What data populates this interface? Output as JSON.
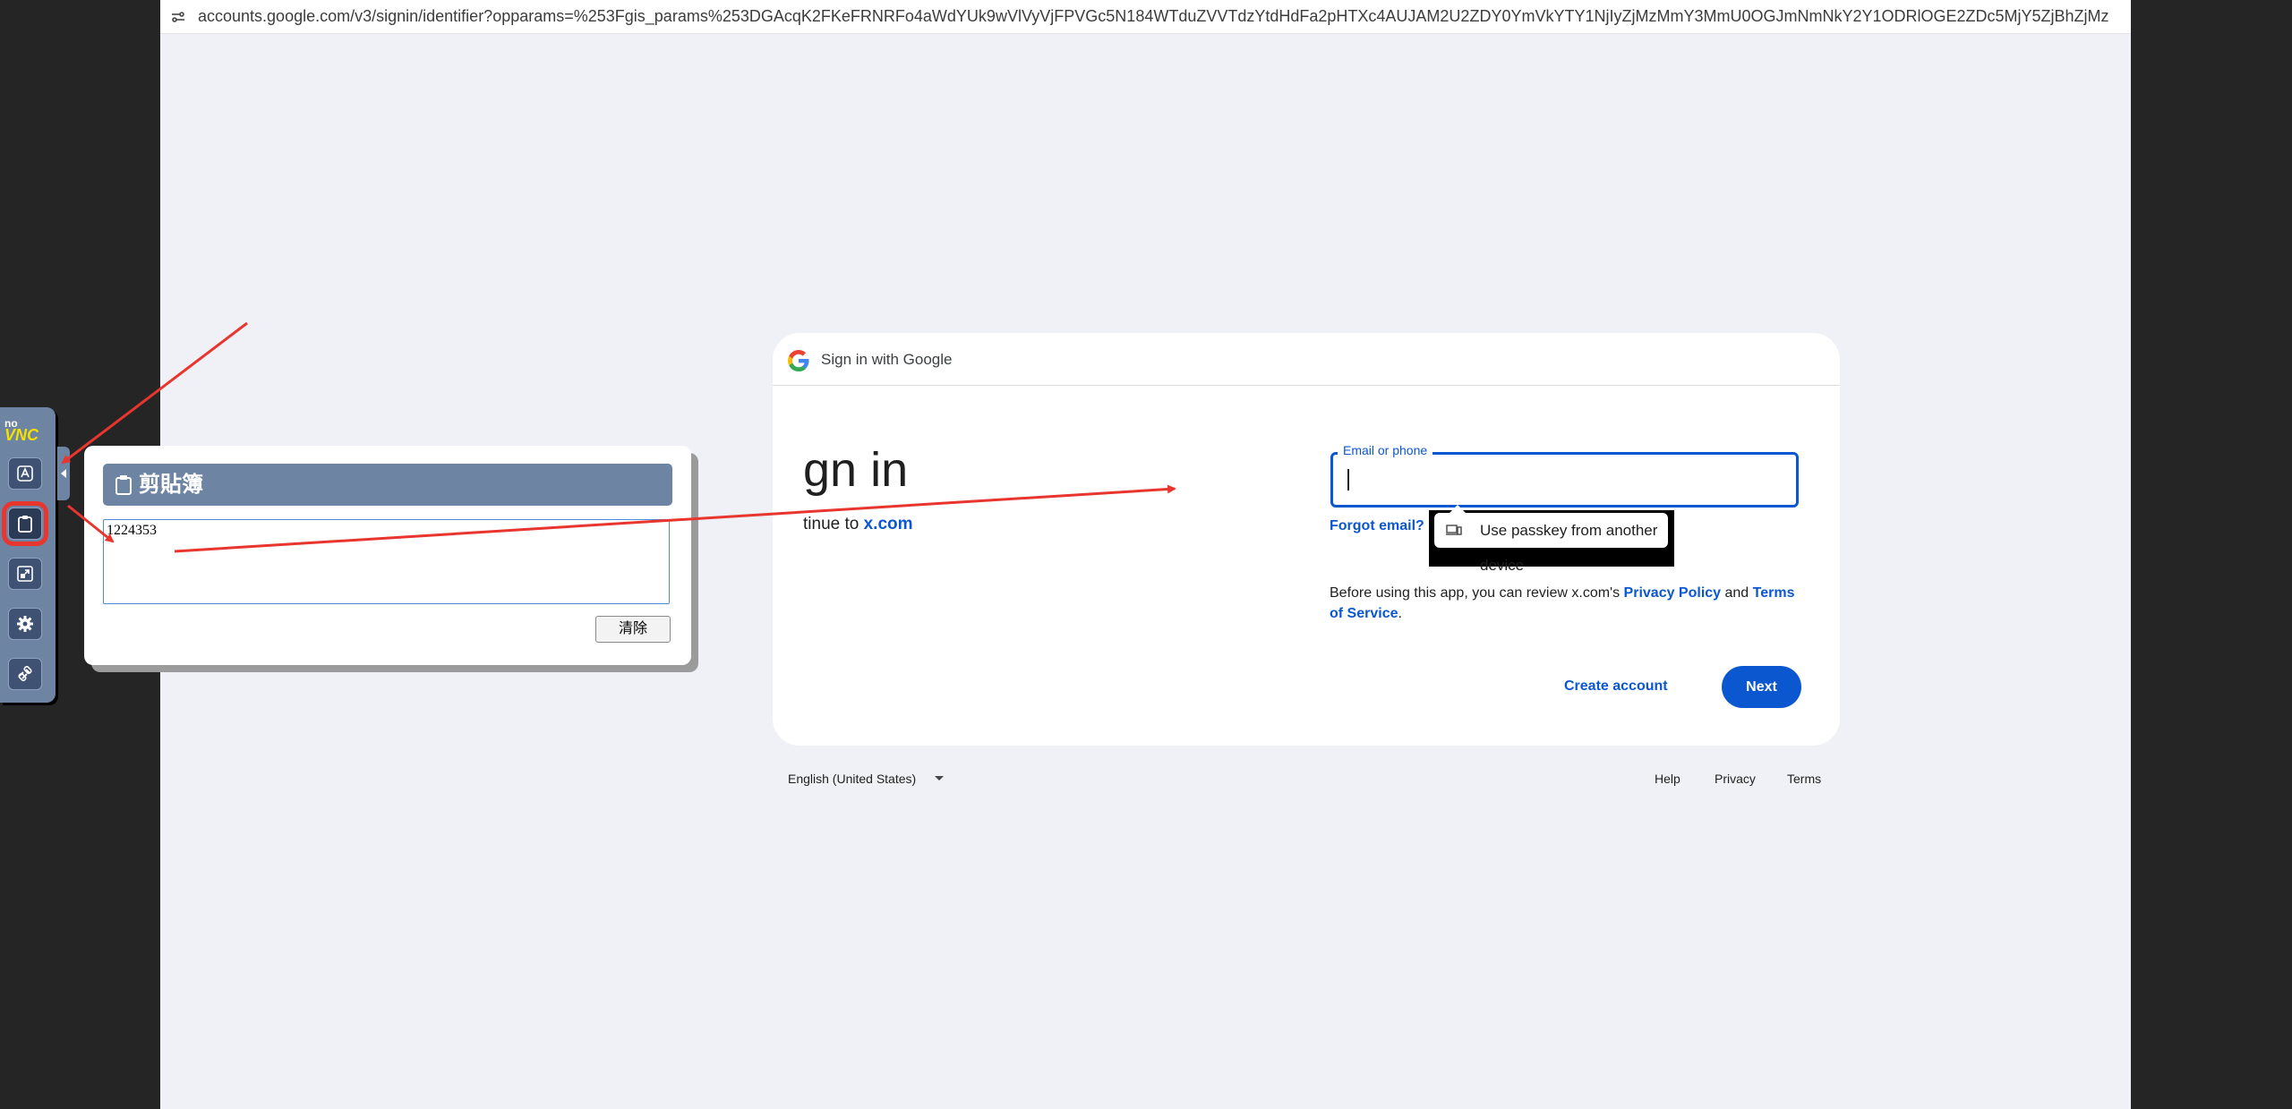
{
  "browser": {
    "url": "accounts.google.com/v3/signin/identifier?opparams=%253Fgis_params%253DGAcqK2FKeFRNRFo4aWdYUk9wVlVyVjFPVGc5N184WTduZVVTdzYtdHdFa2pHTXc4AUJAM2U2ZDY0YmVkYTY1NjIyZjMzMmY3MmU0OGJmNmNkY2Y1ODRlOGE2ZDc5MjY5ZjBhZjMzNWVhZTA5YzY2NDYyNA%252..."
  },
  "signin": {
    "header": "Sign in with Google",
    "title": "gn in",
    "subtitle_prefix": "tinue to ",
    "subtitle_link": "x.com",
    "email_label": "Email or phone",
    "email_value": "",
    "forgot": "Forgot email?",
    "passkey": "Use passkey from another device",
    "disclaimer_prefix": "Before using this app, you can review x.com's ",
    "privacy_policy": "Privacy Policy",
    "and": " and ",
    "terms_of_service": "Terms of Service",
    "period": ".",
    "create_account": "Create account",
    "next": "Next"
  },
  "footer": {
    "language": "English (United States)",
    "help": "Help",
    "privacy": "Privacy",
    "terms": "Terms"
  },
  "vnc": {
    "logo_top": "no",
    "logo_bottom": "VNC",
    "clipboard": {
      "title": "剪貼簿",
      "content": "1224353",
      "clear_label": "清除"
    }
  },
  "colors": {
    "accent": "#0b57d0",
    "annotation": "#e8362f",
    "vnc_panel": "#6e84a3"
  }
}
